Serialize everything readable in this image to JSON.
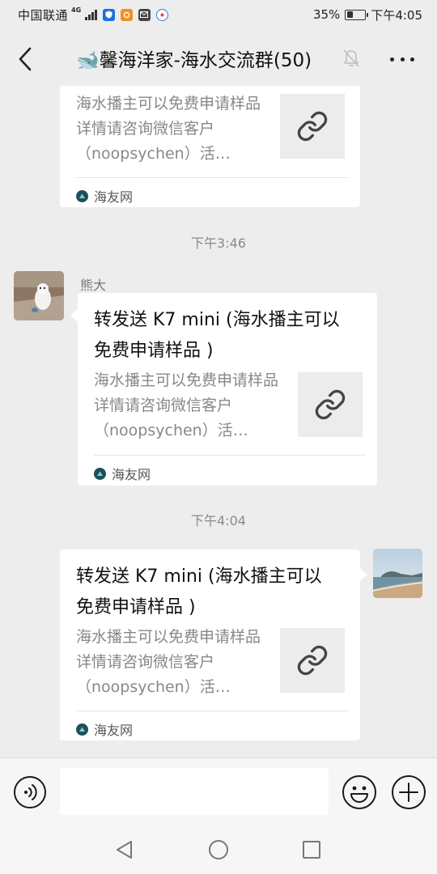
{
  "status_bar": {
    "carrier": "中国联通",
    "network": "4G",
    "battery": "35%",
    "battery_level": 0.35,
    "time": "下午4:05"
  },
  "header": {
    "title": "🐋馨海洋家-海水交流群(50)"
  },
  "messages": [
    {
      "side": "right",
      "link_card": {
        "description": "海水播主可以免费申请样品详情请咨询微信客户（noopsychen）活…",
        "source": "海友网"
      }
    },
    {
      "time_stamp": "下午3:46"
    },
    {
      "side": "left",
      "sender": "熊大",
      "link_card": {
        "title": "转发送 K7 mini (海水播主可以免费申请样品 )",
        "description": "海水播主可以免费申请样品详情请咨询微信客户（noopsychen）活…",
        "source": "海友网"
      }
    },
    {
      "time_stamp": "下午4:04"
    },
    {
      "side": "right",
      "link_card": {
        "title": "转发送 K7 mini (海水播主可以免费申请样品 )",
        "description": "海水播主可以免费申请样品详情请咨询微信客户（noopsychen）活…",
        "source": "海友网"
      }
    }
  ],
  "input_bar": {
    "message_value": ""
  },
  "colors": {
    "background": "#ededed",
    "card": "#ffffff",
    "timestamp": "#8a8a8a"
  }
}
